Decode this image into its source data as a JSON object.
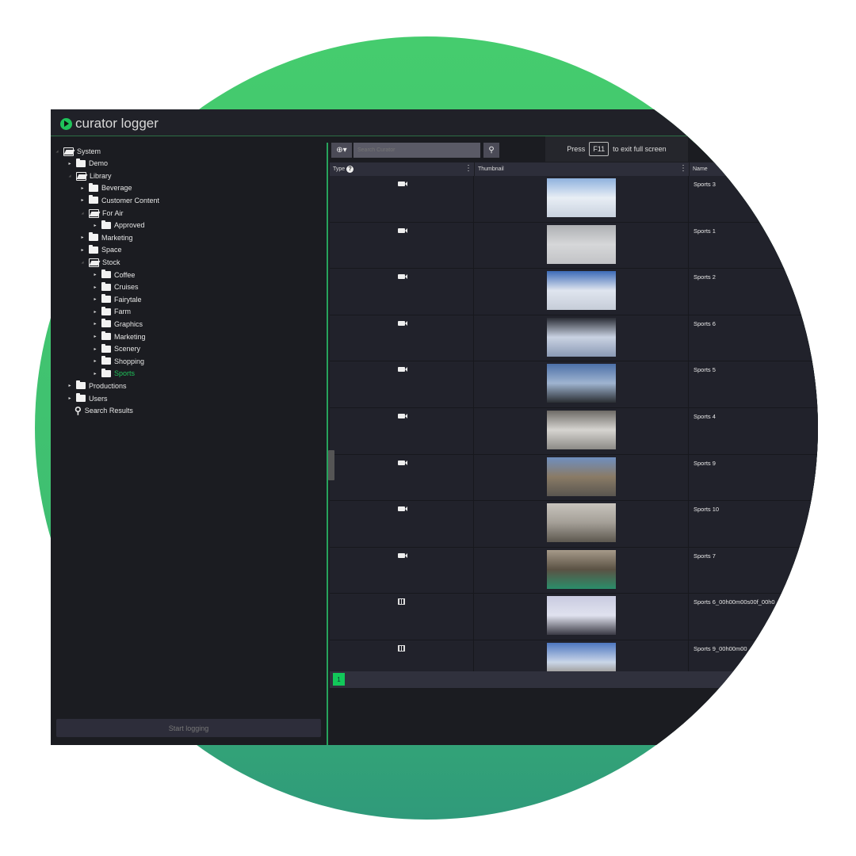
{
  "app": {
    "title": "curator logger",
    "accent": "#1fc25a"
  },
  "tree": [
    {
      "label": "System",
      "depth": 0,
      "icon": "folder-open",
      "toggle": "expanded"
    },
    {
      "label": "Demo",
      "depth": 1,
      "icon": "folder",
      "toggle": "collapsed"
    },
    {
      "label": "Library",
      "depth": 1,
      "icon": "folder-open",
      "toggle": "expanded"
    },
    {
      "label": "Beverage",
      "depth": 2,
      "icon": "folder",
      "toggle": "collapsed"
    },
    {
      "label": "Customer Content",
      "depth": 2,
      "icon": "folder",
      "toggle": "collapsed"
    },
    {
      "label": "For Air",
      "depth": 2,
      "icon": "folder-open",
      "toggle": "expanded"
    },
    {
      "label": "Approved",
      "depth": 3,
      "icon": "folder",
      "toggle": "collapsed"
    },
    {
      "label": "Marketing",
      "depth": 2,
      "icon": "folder",
      "toggle": "collapsed"
    },
    {
      "label": "Space",
      "depth": 2,
      "icon": "folder",
      "toggle": "collapsed"
    },
    {
      "label": "Stock",
      "depth": 2,
      "icon": "folder-open",
      "toggle": "expanded"
    },
    {
      "label": "Coffee",
      "depth": 3,
      "icon": "folder",
      "toggle": "collapsed"
    },
    {
      "label": "Cruises",
      "depth": 3,
      "icon": "folder",
      "toggle": "collapsed"
    },
    {
      "label": "Fairytale",
      "depth": 3,
      "icon": "folder",
      "toggle": "collapsed"
    },
    {
      "label": "Farm",
      "depth": 3,
      "icon": "folder",
      "toggle": "collapsed"
    },
    {
      "label": "Graphics",
      "depth": 3,
      "icon": "folder",
      "toggle": "collapsed"
    },
    {
      "label": "Marketing",
      "depth": 3,
      "icon": "folder",
      "toggle": "collapsed"
    },
    {
      "label": "Scenery",
      "depth": 3,
      "icon": "folder",
      "toggle": "collapsed"
    },
    {
      "label": "Shopping",
      "depth": 3,
      "icon": "folder",
      "toggle": "collapsed"
    },
    {
      "label": "Sports",
      "depth": 3,
      "icon": "folder",
      "toggle": "collapsed",
      "selected": true
    },
    {
      "label": "Productions",
      "depth": 1,
      "icon": "folder",
      "toggle": "collapsed"
    },
    {
      "label": "Users",
      "depth": 1,
      "icon": "folder",
      "toggle": "collapsed"
    },
    {
      "label": "Search Results",
      "depth": 1,
      "icon": "search",
      "toggle": "none"
    }
  ],
  "sidebar": {
    "start_logging": "Start logging"
  },
  "search": {
    "placeholder": "Search Curator"
  },
  "fullscreen": {
    "press": "Press",
    "key": "F11",
    "rest": "to exit full screen"
  },
  "table": {
    "columns": {
      "type": "Type",
      "thumbnail": "Thumbnail",
      "name": "Name"
    },
    "rows": [
      {
        "type": "video",
        "name": "Sports 3",
        "thumb": [
          "#8fb2de",
          "#e8eef5",
          "#c9d2df"
        ]
      },
      {
        "type": "video",
        "name": "Sports 1",
        "thumb": [
          "#aeb0b3",
          "#d6d7d9",
          "#c2c3c6"
        ]
      },
      {
        "type": "video",
        "name": "Sports 2",
        "thumb": [
          "#3d6bb8",
          "#dfe5ef",
          "#c6cdd8"
        ]
      },
      {
        "type": "video",
        "name": "Sports 6",
        "thumb": [
          "#2a2d35",
          "#c9d2e2",
          "#8b9ab5"
        ]
      },
      {
        "type": "video",
        "name": "Sports 5",
        "thumb": [
          "#4c70a8",
          "#9fb4d0",
          "#2b2f33"
        ]
      },
      {
        "type": "video",
        "name": "Sports 4",
        "thumb": [
          "#6d6a66",
          "#d6d4d0",
          "#8c8a86"
        ]
      },
      {
        "type": "video",
        "name": "Sports 9",
        "thumb": [
          "#6f8fbf",
          "#8a7b66",
          "#5a5650"
        ]
      },
      {
        "type": "video",
        "name": "Sports 10",
        "thumb": [
          "#c8c4bd",
          "#a49f97",
          "#5d584f"
        ]
      },
      {
        "type": "video",
        "name": "Sports 7",
        "thumb": [
          "#a69a8a",
          "#5b5244",
          "#2a8e6a"
        ]
      },
      {
        "type": "clip",
        "name": "Sports 6_00h00m00s00f_00h0",
        "thumb": [
          "#c9cbe0",
          "#e0e2ef",
          "#3a3a44"
        ]
      },
      {
        "type": "clip",
        "name": "Sports 9_00h00m00",
        "thumb": [
          "#4d76c0",
          "#c9d6e8",
          "#7a6a55"
        ]
      }
    ]
  },
  "pager": {
    "current": "1"
  }
}
